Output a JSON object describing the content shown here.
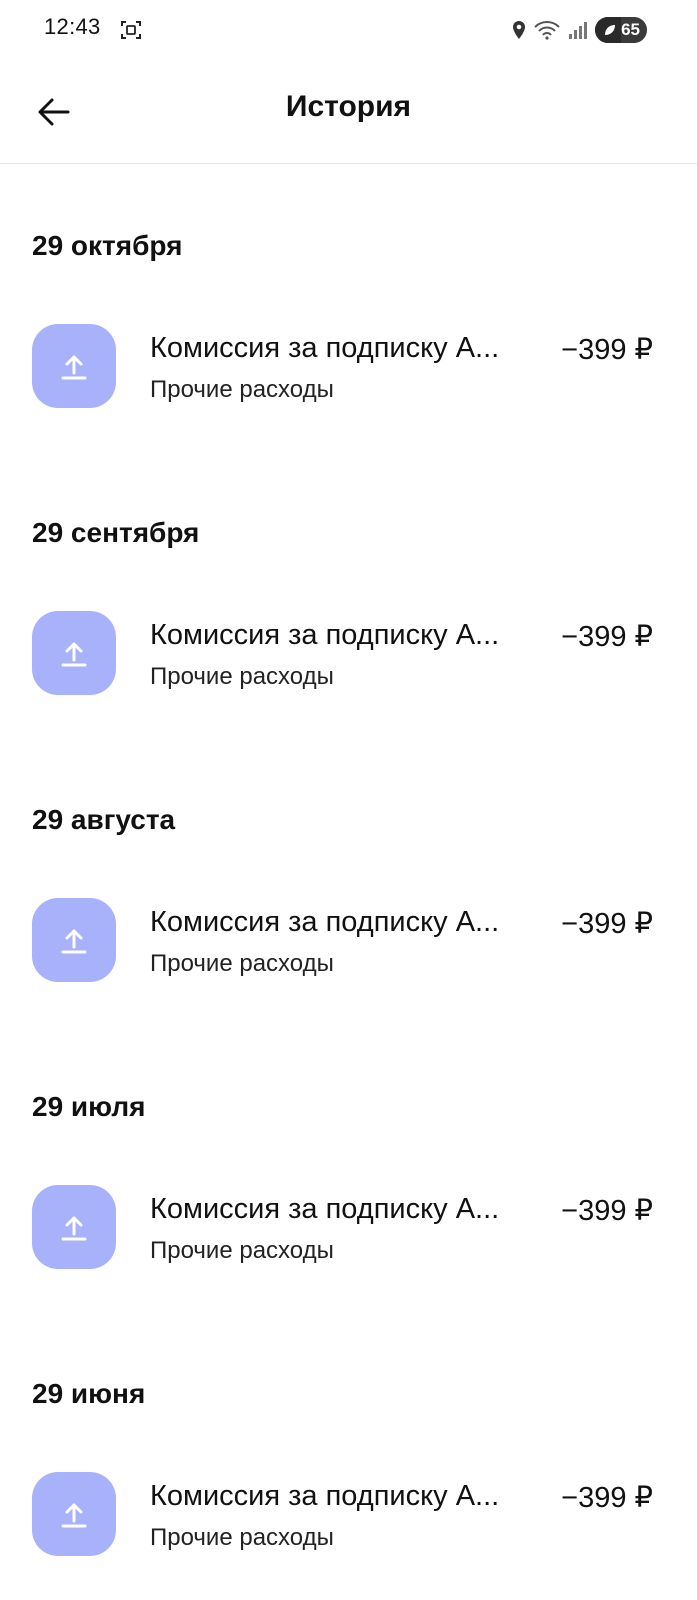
{
  "status_bar": {
    "time": "12:43",
    "battery": "65",
    "icons": [
      "screen-capture-icon",
      "location-icon",
      "wifi-icon",
      "signal-icon",
      "battery-saver-icon"
    ]
  },
  "header": {
    "title": "История",
    "back_icon": "arrow-left-icon"
  },
  "accent_colors": {
    "icon_bg": "#a8b2fb"
  },
  "groups": [
    {
      "date": "29 октября",
      "tx": {
        "title": "Комиссия за подписку А...",
        "category": "Прочие расходы",
        "amount": "−399 ₽",
        "icon": "upload-arrow-icon"
      }
    },
    {
      "date": "29 сентября",
      "tx": {
        "title": "Комиссия за подписку А...",
        "category": "Прочие расходы",
        "amount": "−399 ₽",
        "icon": "upload-arrow-icon"
      }
    },
    {
      "date": "29 августа",
      "tx": {
        "title": "Комиссия за подписку А...",
        "category": "Прочие расходы",
        "amount": "−399 ₽",
        "icon": "upload-arrow-icon"
      }
    },
    {
      "date": "29 июля",
      "tx": {
        "title": "Комиссия за подписку А...",
        "category": "Прочие расходы",
        "amount": "−399 ₽",
        "icon": "upload-arrow-icon"
      }
    },
    {
      "date": "29 июня",
      "tx": {
        "title": "Комиссия за подписку А...",
        "category": "Прочие расходы",
        "amount": "−399 ₽",
        "icon": "upload-arrow-icon"
      }
    }
  ]
}
